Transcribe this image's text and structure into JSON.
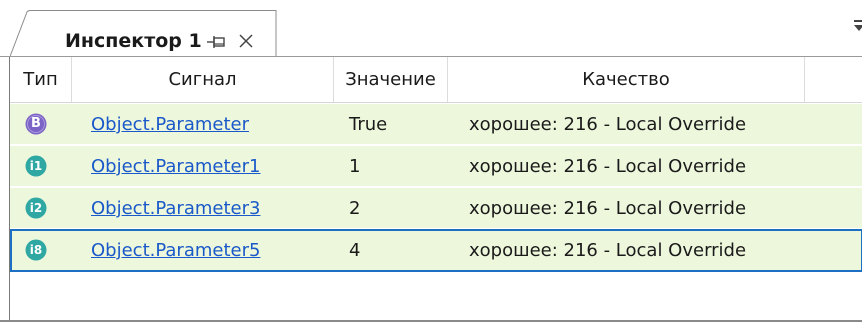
{
  "tab": {
    "title": "Инспектор 1",
    "icons": [
      "pin-icon",
      "close-icon"
    ]
  },
  "grid": {
    "headers": {
      "type": "Тип",
      "signal": "Сигнал",
      "value": "Значение",
      "quality": "Качество"
    },
    "rows": [
      {
        "type_badge": "B",
        "signal": "Object.Parameter",
        "value": "True",
        "quality": "хорошее: 216 - Local Override",
        "selected": false
      },
      {
        "type_badge": "i1",
        "signal": "Object.Parameter1",
        "value": "1",
        "quality": "хорошее: 216 - Local Override",
        "selected": false
      },
      {
        "type_badge": "i2",
        "signal": "Object.Parameter3",
        "value": "2",
        "quality": "хорошее: 216 - Local Override",
        "selected": false
      },
      {
        "type_badge": "i8",
        "signal": "Object.Parameter5",
        "value": "4",
        "quality": "хорошее: 216 - Local Override",
        "selected": true
      }
    ]
  },
  "colors": {
    "row_background": "#edf7dc",
    "link": "#1a59c9",
    "selection_border": "#1d6fc4",
    "boolean_badge": "#7b63c7",
    "integer_badge": "#2fa7a3"
  }
}
